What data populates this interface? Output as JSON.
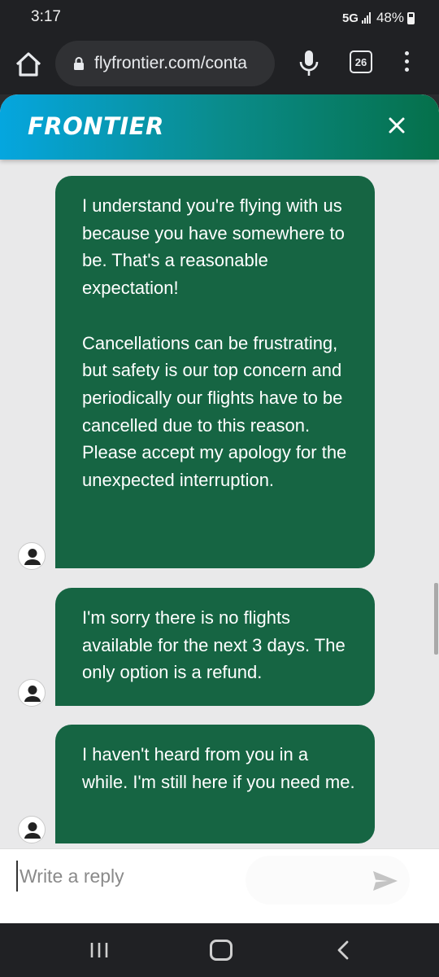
{
  "status": {
    "time": "3:17",
    "network": "5G",
    "battery": "48%"
  },
  "browser": {
    "url": "flyfrontier.com/conta",
    "tab_count": "26"
  },
  "chat": {
    "brand": "FRONTIER",
    "messages": [
      {
        "text": " I understand you're flying with us because you have somewhere to be. That's a reasonable expectation!\n\nCancellations can be frustrating, but safety is our top concern and periodically our flights have to be cancelled due to this reason. Please accept my apology for the unexpected interruption."
      },
      {
        "text": "I'm sorry there is no flights available for the next 3 days. The only option is a refund."
      },
      {
        "text": "I haven't heard from you in a while. I'm still here if you need me."
      }
    ],
    "reply_placeholder": "Write a reply"
  },
  "colors": {
    "bubble": "#166543",
    "header_start": "#05a6df",
    "header_end": "#05704a"
  },
  "icons": [
    "home-icon",
    "lock-icon",
    "mic-icon",
    "tabs-icon",
    "menu-icon",
    "close-icon",
    "user-icon",
    "send-icon",
    "recents-icon",
    "circle-home-icon",
    "back-icon"
  ]
}
